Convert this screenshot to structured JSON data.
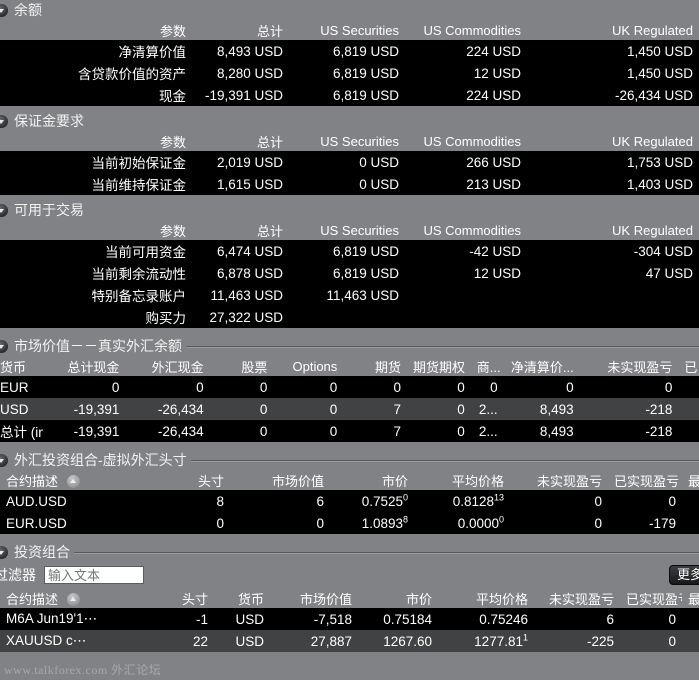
{
  "colors": {
    "panel_bg": "#808285",
    "grid_bg": "#000000",
    "row_alt": "#414244",
    "text": "#ffffff",
    "button_bg": "#18191a"
  },
  "sections": {
    "balances": {
      "title": "余额",
      "columns": [
        "参数",
        "总计",
        "US Securities",
        "US Commodities",
        "UK Regulated"
      ],
      "rows": [
        {
          "param": "净清算价值",
          "total": "8,493 USD",
          "us_sec": "6,819 USD",
          "us_com": "224 USD",
          "uk_reg": "1,450 USD"
        },
        {
          "param": "含贷款价值的资产",
          "total": "8,280 USD",
          "us_sec": "6,819 USD",
          "us_com": "12 USD",
          "uk_reg": "1,450 USD"
        },
        {
          "param": "现金",
          "total": "-19,391 USD",
          "us_sec": "6,819 USD",
          "us_com": "224 USD",
          "uk_reg": "-26,434 USD"
        }
      ]
    },
    "margin": {
      "title": "保证金要求",
      "columns": [
        "参数",
        "总计",
        "US Securities",
        "US Commodities",
        "UK Regulated"
      ],
      "rows": [
        {
          "param": "当前初始保证金",
          "total": "2,019 USD",
          "us_sec": "0 USD",
          "us_com": "266 USD",
          "uk_reg": "1,753 USD"
        },
        {
          "param": "当前维持保证金",
          "total": "1,615 USD",
          "us_sec": "0 USD",
          "us_com": "213 USD",
          "uk_reg": "1,403 USD"
        }
      ]
    },
    "available": {
      "title": "可用于交易",
      "columns": [
        "参数",
        "总计",
        "US Securities",
        "US Commodities",
        "UK Regulated"
      ],
      "rows": [
        {
          "param": "当前可用资金",
          "total": "6,474 USD",
          "us_sec": "6,819 USD",
          "us_com": "-42 USD",
          "uk_reg": "-304 USD"
        },
        {
          "param": "当前剩余流动性",
          "total": "6,878 USD",
          "us_sec": "6,819 USD",
          "us_com": "12 USD",
          "uk_reg": "47 USD"
        },
        {
          "param": "特别备忘录账户",
          "total": "11,463 USD",
          "us_sec": "11,463 USD",
          "us_com": "",
          "uk_reg": ""
        },
        {
          "param": "购买力",
          "total": "27,322 USD",
          "us_sec": "",
          "us_com": "",
          "uk_reg": ""
        }
      ]
    },
    "market_value": {
      "title": "市场价值－－真实外汇余额",
      "columns": [
        "货币",
        "总计现金",
        "外汇现金",
        "股票",
        "Options",
        "期货",
        "期货期权",
        "商...",
        "净清算价...",
        "未实现盈亏",
        "已"
      ],
      "rows": [
        {
          "cur": "EUR",
          "total_cash": "0",
          "fx_cash": "0",
          "stock": "0",
          "options": "0",
          "futures": "0",
          "fut_opt": "0",
          "com": "0",
          "nlv": "0",
          "upnl": "0",
          "extra": ""
        },
        {
          "cur": "USD",
          "total_cash": "-19,391",
          "fx_cash": "-26,434",
          "stock": "0",
          "options": "0",
          "futures": "7",
          "fut_opt": "0",
          "com": "2...",
          "nlv": "8,493",
          "upnl": "-218",
          "extra": ""
        },
        {
          "cur": "总计 (in ...",
          "total_cash": "-19,391",
          "fx_cash": "-26,434",
          "stock": "0",
          "options": "0",
          "futures": "7",
          "fut_opt": "0",
          "com": "2...",
          "nlv": "8,493",
          "upnl": "-218",
          "extra": ""
        }
      ]
    },
    "fx_portfolio": {
      "title": "外汇投资组合-虚拟外汇头寸",
      "columns": [
        "合约描述",
        "头寸",
        "市场价值",
        "市价",
        "平均价格",
        "未实现盈亏",
        "已实现盈亏",
        "最"
      ],
      "sort_column": "合约描述",
      "sort_direction": "asc",
      "rows": [
        {
          "desc": "AUD.USD",
          "pos": "8",
          "mkt_val": "6",
          "last_main": "0.7525",
          "last_sup": "0",
          "avg_main": "0.8128",
          "avg_sup": "13",
          "upnl": "0",
          "rpnl": "0"
        },
        {
          "desc": "EUR.USD",
          "pos": "0",
          "mkt_val": "0",
          "last_main": "1.0893",
          "last_sup": "8",
          "avg_main": "0.0000",
          "avg_sup": "0",
          "upnl": "0",
          "rpnl": "-179"
        }
      ]
    },
    "portfolio": {
      "title": "投资组合",
      "filter_label": "过滤器",
      "filter_value": "",
      "filter_placeholder": "输入文本",
      "more_button": "更多",
      "columns": [
        "合约描述",
        "头寸",
        "货币",
        "市场价值",
        "市价",
        "平均价格",
        "未实现盈亏",
        "已实现盈亏",
        "最"
      ],
      "sort_column": "合约描述",
      "sort_direction": "asc",
      "rows": [
        {
          "desc": "M6A Jun19'1⋯",
          "pos": "-1",
          "cur": "USD",
          "mkt_val": "-7,518",
          "last_main": "0.75184",
          "last_sup": "",
          "avg_main": "0.75246",
          "avg_sup": "",
          "upnl": "6",
          "rpnl": "0"
        },
        {
          "desc": "XAUUSD c⋯",
          "pos": "22",
          "cur": "USD",
          "mkt_val": "27,887",
          "last_main": "1267.60",
          "last_sup": "",
          "avg_main": "1277.81",
          "avg_sup": "1",
          "upnl": "-225",
          "rpnl": "0"
        }
      ]
    }
  },
  "watermark": "www.talkforex.com 外汇论坛"
}
